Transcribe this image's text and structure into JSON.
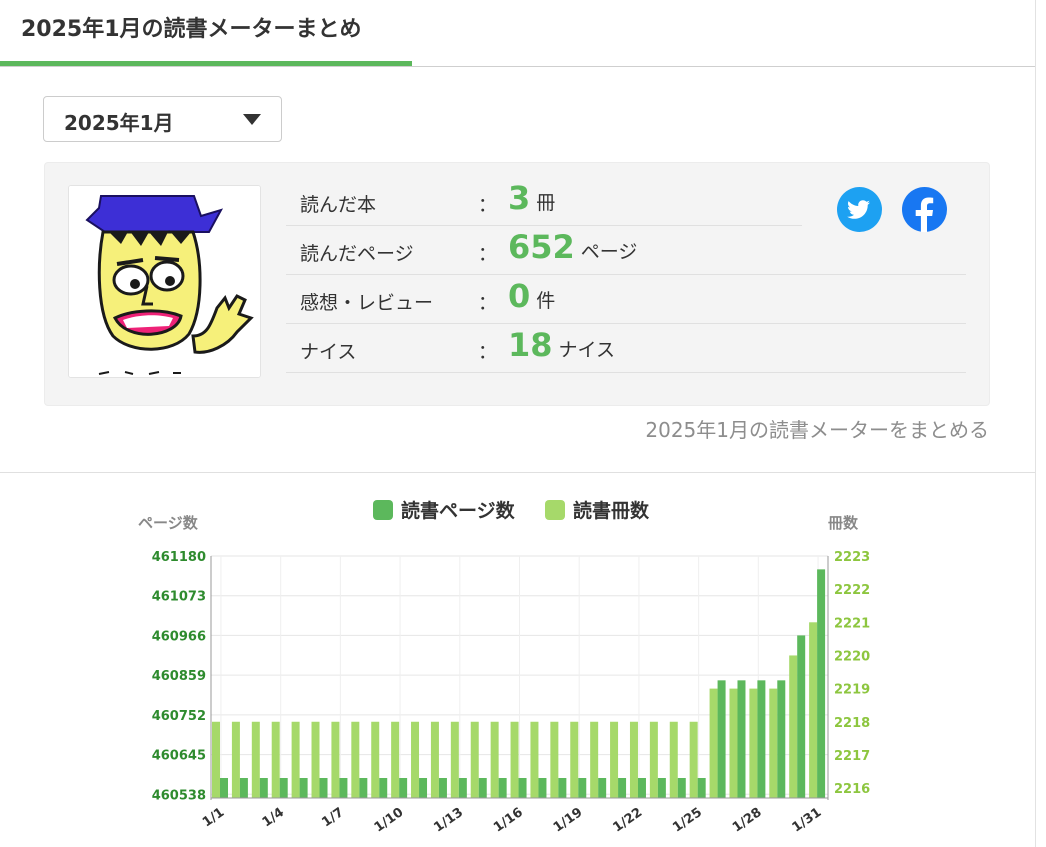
{
  "header": {
    "title": "2025年1月の読書メーターまとめ"
  },
  "month_select": {
    "value": "2025年1月"
  },
  "stats": [
    {
      "label": "読んだ本",
      "colon": "：",
      "value": "3",
      "unit": "冊"
    },
    {
      "label": "読んだページ",
      "colon": "：",
      "value": "652",
      "unit": "ページ"
    },
    {
      "label": "感想・レビュー",
      "colon": "：",
      "value": "0",
      "unit": "件"
    },
    {
      "label": "ナイス",
      "colon": "：",
      "value": "18",
      "unit": "ナイス"
    }
  ],
  "summarize_link": "2025年1月の読書メーターをまとめる",
  "social": {
    "twitter_icon": "twitter-icon",
    "facebook_icon": "facebook-icon"
  },
  "colors": {
    "accent": "#5cb85c",
    "pages_series": "#5cb85c",
    "books_series": "#a6d96a"
  },
  "chart_data": {
    "type": "bar",
    "legend": [
      "読書ページ数",
      "読書冊数"
    ],
    "legend_position": "top",
    "ylabel_left": "ページ数",
    "ylabel_right": "冊数",
    "categories": [
      "1/1",
      "1/2",
      "1/3",
      "1/4",
      "1/5",
      "1/6",
      "1/7",
      "1/8",
      "1/9",
      "1/10",
      "1/11",
      "1/12",
      "1/13",
      "1/14",
      "1/15",
      "1/16",
      "1/17",
      "1/18",
      "1/19",
      "1/20",
      "1/21",
      "1/22",
      "1/23",
      "1/24",
      "1/25",
      "1/26",
      "1/27",
      "1/28",
      "1/29",
      "1/30",
      "1/31"
    ],
    "x_tick_labels": [
      "1/1",
      "1/4",
      "1/7",
      "1/10",
      "1/13",
      "1/16",
      "1/19",
      "1/22",
      "1/25",
      "1/28",
      "1/31"
    ],
    "left_ticks": [
      460538,
      460645,
      460752,
      460859,
      460966,
      461073,
      461180
    ],
    "right_ticks": [
      2216,
      2217,
      2218,
      2219,
      2220,
      2221,
      2222,
      2223
    ],
    "ylim_left": [
      460528,
      461180
    ],
    "ylim_right": [
      2215.7,
      2223
    ],
    "grid": true,
    "series": [
      {
        "name": "読書ページ数",
        "axis": "left",
        "values": [
          460528,
          460528,
          460528,
          460528,
          460528,
          460528,
          460528,
          460528,
          460528,
          460528,
          460528,
          460528,
          460528,
          460528,
          460528,
          460528,
          460528,
          460528,
          460528,
          460528,
          460528,
          460528,
          460528,
          460528,
          460528,
          460845,
          460845,
          460845,
          460845,
          460966,
          461144
        ]
      },
      {
        "name": "読書冊数",
        "axis": "right",
        "values": [
          2218,
          2218,
          2218,
          2218,
          2218,
          2218,
          2218,
          2218,
          2218,
          2218,
          2218,
          2218,
          2218,
          2218,
          2218,
          2218,
          2218,
          2218,
          2218,
          2218,
          2218,
          2218,
          2218,
          2218,
          2218,
          2219,
          2219,
          2219,
          2219,
          2220,
          2221
        ]
      }
    ]
  }
}
